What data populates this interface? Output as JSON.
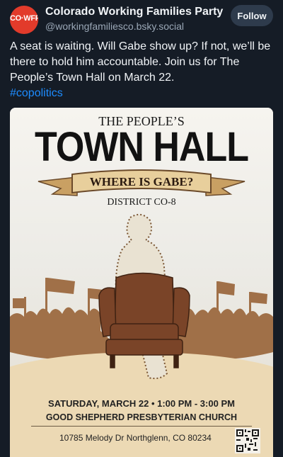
{
  "post": {
    "avatar_text": "CO·WFP",
    "author_name": "Colorado Working Families Party",
    "handle": "@workingfamiliesco.bsky.social",
    "follow_label": "Follow",
    "text": "A seat is waiting. Will Gabe show up? If not, we’ll be there to hold him accountable. Join us for The People’s Town Hall on March 22.",
    "hashtag": "#copolitics"
  },
  "poster": {
    "subtitle": "THE PEOPLE’S",
    "title": "TOWN HALL",
    "banner": "WHERE IS GABE?",
    "district": "DISTRICT CO-8",
    "date_time": "SATURDAY, MARCH 22 • 1:00 PM - 3:00 PM",
    "venue": "GOOD SHEPHERD PRESBYTERIAN CHURCH",
    "address": "10785 Melody Dr Northglenn, CO 80234"
  },
  "colors": {
    "background": "#151c26",
    "accent_link": "#1d8cff",
    "avatar": "#e23b2b",
    "poster_paper": "#f2efe9",
    "crowd": "#a07048",
    "chair": "#7a4428"
  },
  "icons": [
    "qr-code-icon"
  ]
}
